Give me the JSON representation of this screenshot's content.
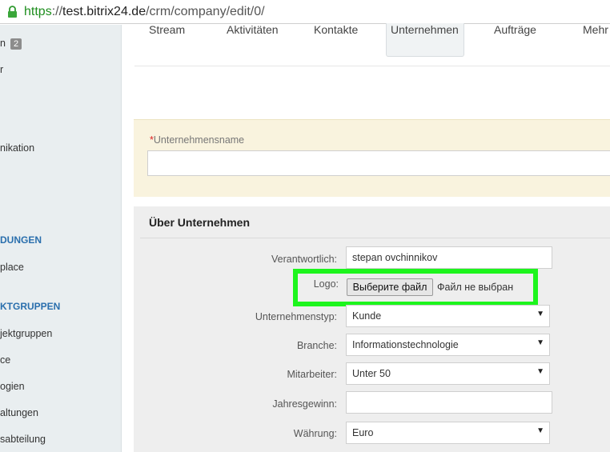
{
  "browser": {
    "url_scheme": "https",
    "url_separator": "://",
    "url_host": "test.bitrix24.de",
    "url_path": "/crm/company/edit/0/"
  },
  "sidebar": {
    "items": [
      {
        "label": "n",
        "badge": "2"
      },
      {
        "label": "r"
      },
      {
        "label": "nikation"
      }
    ],
    "section_1": "DUNGEN",
    "section_1_items": [
      "place"
    ],
    "section_2": "KTGRUPPEN",
    "section_2_items": [
      "jektgruppen",
      "ce",
      "ogien",
      "altungen",
      "sabteilung"
    ]
  },
  "tabs": [
    {
      "label": "Stream"
    },
    {
      "label": "Aktivitäten"
    },
    {
      "label": "Kontakte"
    },
    {
      "label": "Unternehmen",
      "active": true
    },
    {
      "label": "Aufträge"
    },
    {
      "label": "Mehr"
    }
  ],
  "company_name": {
    "required_marker": "*",
    "label": "Unternehmensname",
    "value": ""
  },
  "about": {
    "title": "Über Unternehmen",
    "responsible_label": "Verantwortlich:",
    "responsible_value": "stepan ovchinnikov",
    "logo_label": "Logo:",
    "file_button": "Выберите файл",
    "file_status": "Файл не выбран",
    "type_label": "Unternehmenstyp:",
    "type_value": "Kunde",
    "industry_label": "Branche:",
    "industry_value": "Informationstechnologie",
    "employees_label": "Mitarbeiter:",
    "employees_value": "Unter 50",
    "revenue_label": "Jahresgewinn:",
    "revenue_value": "",
    "currency_label": "Währung:",
    "currency_value": "Euro"
  },
  "colors": {
    "highlight": "#1df51d",
    "section_link": "#2a6fad",
    "https_green": "#1e8e1e"
  },
  "icons": {
    "lock": "lock-icon",
    "dropdown": "dropdown-arrow-icon"
  }
}
